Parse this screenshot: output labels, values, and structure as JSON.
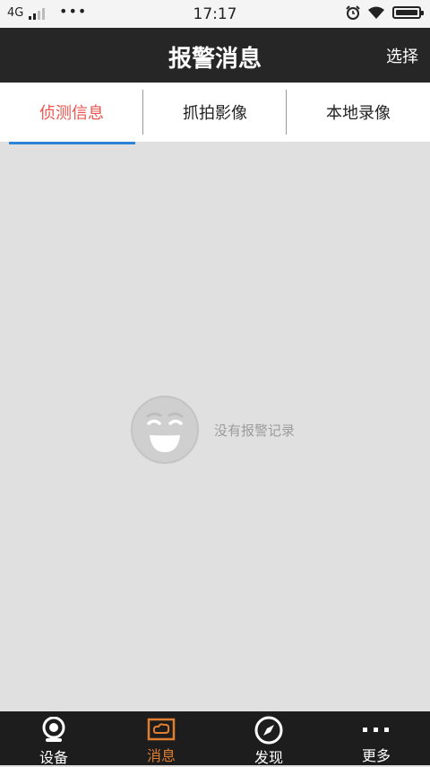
{
  "status_bar": {
    "network": "4G",
    "dots": "•••",
    "time": "17:17"
  },
  "header": {
    "title": "报警消息",
    "select_label": "选择"
  },
  "tabs": [
    {
      "label": "侦测信息",
      "active": true
    },
    {
      "label": "抓拍影像",
      "active": false
    },
    {
      "label": "本地录像",
      "active": false
    }
  ],
  "empty_state": {
    "text": "没有报警记录",
    "icon": "smiley-face-icon"
  },
  "bottom_nav": [
    {
      "label": "设备",
      "icon": "camera-icon",
      "active": false
    },
    {
      "label": "消息",
      "icon": "message-cloud-icon",
      "active": true
    },
    {
      "label": "发现",
      "icon": "compass-icon",
      "active": false
    },
    {
      "label": "更多",
      "icon": "more-dots-icon",
      "active": false
    }
  ],
  "colors": {
    "accent": "#e8554f",
    "underline": "#2c84d6",
    "nav_active": "#e07e31",
    "header_bg": "#262626"
  }
}
